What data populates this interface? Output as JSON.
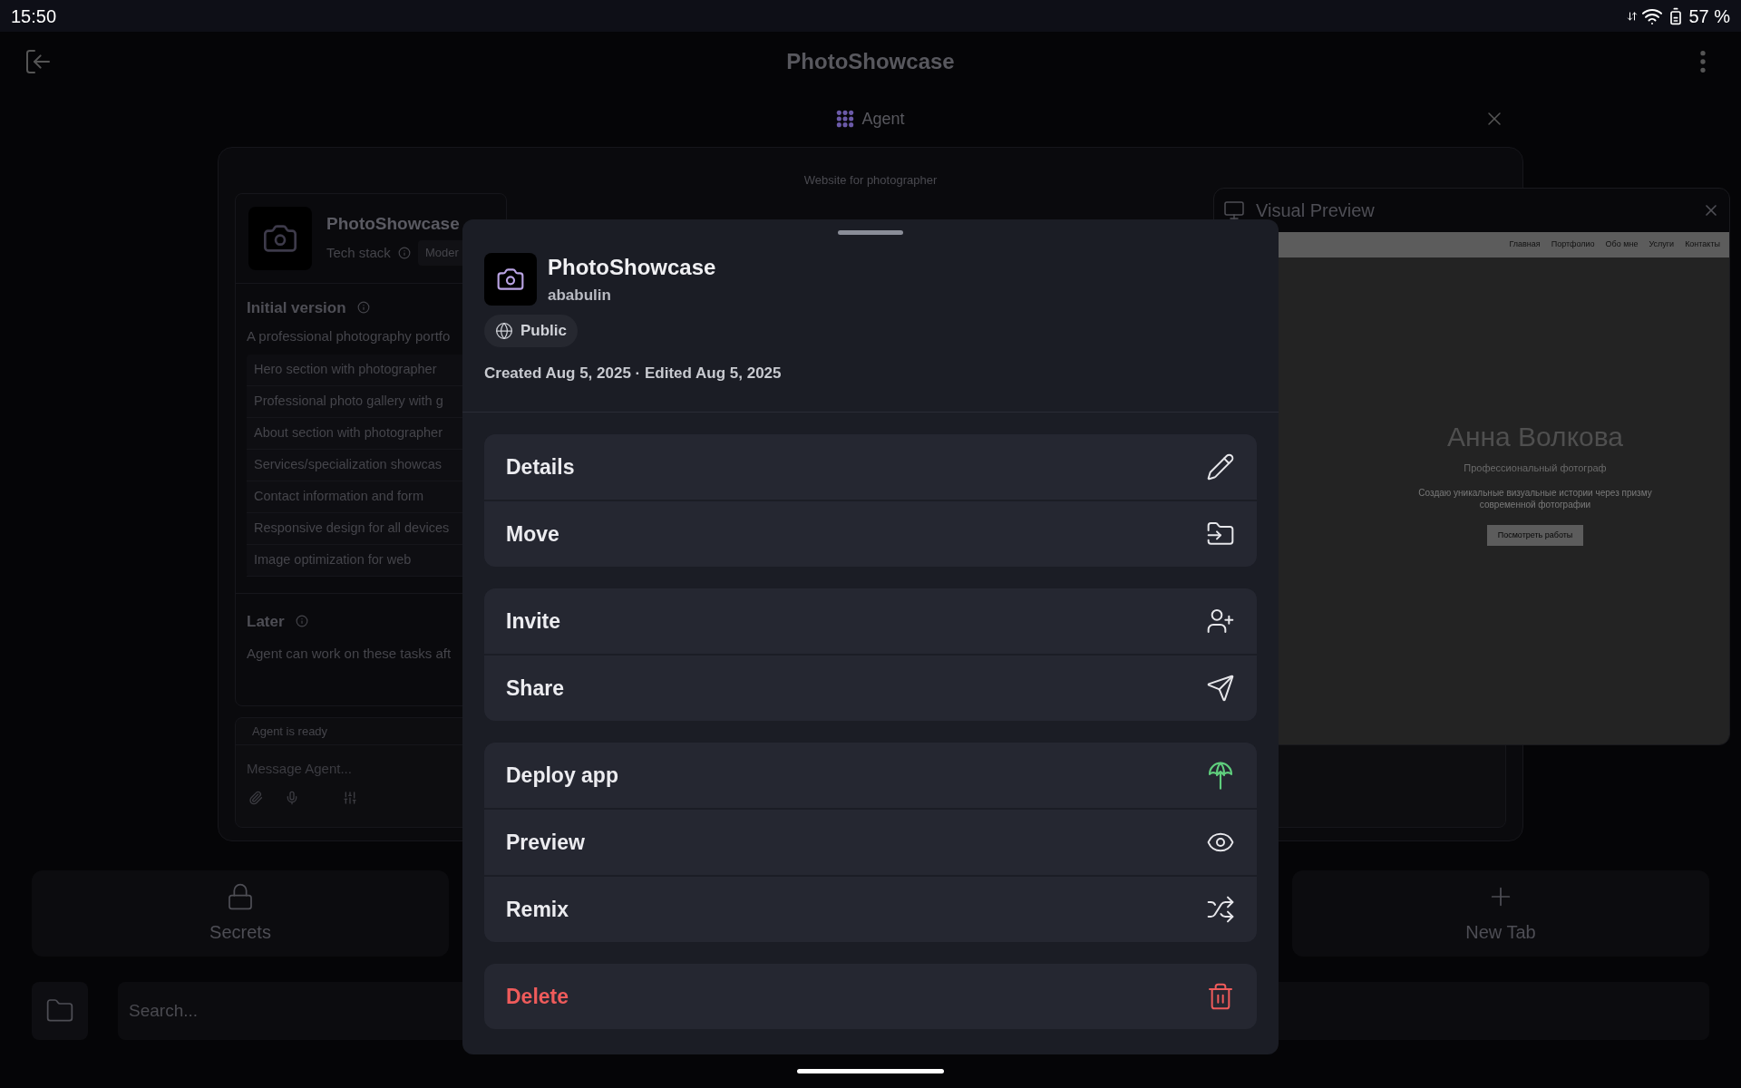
{
  "status_bar": {
    "time": "15:50",
    "battery": "57 %"
  },
  "app_bar": {
    "title": "PhotoShowcase"
  },
  "agent_tab": {
    "label": "Agent"
  },
  "panel": {
    "subtitle": "Website for photographer",
    "project": {
      "name": "PhotoShowcase",
      "tech_stack_label": "Tech stack",
      "chip": "Moder"
    },
    "initial_version": {
      "heading": "Initial version",
      "description": "A professional photography portfo",
      "items": [
        "Hero section with photographer",
        "Professional photo gallery with g",
        "About section with photographer",
        "Services/specialization showcas",
        "Contact information and form",
        "Responsive design for all devices",
        "Image optimization for web"
      ]
    },
    "later": {
      "heading": "Later",
      "description": "Agent can work on these tasks aft"
    },
    "composer": {
      "status": "Agent is ready",
      "placeholder": "Message Agent..."
    }
  },
  "visual_preview": {
    "title": "Visual Preview",
    "site": {
      "nav": [
        "Главная",
        "Портфолио",
        "Обо мне",
        "Услуги",
        "Контакты"
      ],
      "heading": "Анна Волкова",
      "subtitle": "Профессиональный фотограф",
      "tagline": "Создаю уникальные визуальные истории через призму современной фотографии",
      "button": "Посмотреть работы"
    }
  },
  "bottom_tabs": [
    {
      "kind": "secrets",
      "label": "Secrets"
    },
    {
      "kind": "new",
      "label": "New Tab"
    }
  ],
  "search": {
    "placeholder": "Search..."
  },
  "sheet": {
    "name": "PhotoShowcase",
    "owner": "ababulin",
    "visibility": "Public",
    "dates": "Created Aug 5, 2025 · Edited Aug 5, 2025",
    "groups": [
      [
        {
          "label": "Details",
          "kind": "edit",
          "danger": false
        },
        {
          "label": "Move",
          "kind": "move",
          "danger": false
        }
      ],
      [
        {
          "label": "Invite",
          "kind": "invite",
          "danger": false
        },
        {
          "label": "Share",
          "kind": "share",
          "danger": false
        }
      ],
      [
        {
          "label": "Deploy app",
          "kind": "deploy",
          "danger": false
        },
        {
          "label": "Preview",
          "kind": "preview",
          "danger": false
        },
        {
          "label": "Remix",
          "kind": "remix",
          "danger": false
        }
      ],
      [
        {
          "label": "Delete",
          "kind": "delete",
          "danger": true
        }
      ]
    ]
  }
}
